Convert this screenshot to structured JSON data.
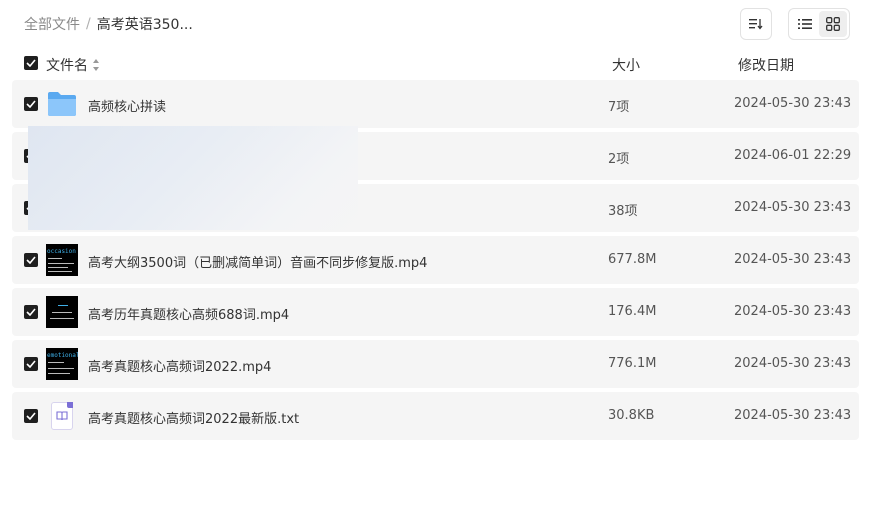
{
  "breadcrumb": {
    "root": "全部文件",
    "separator": "/",
    "current": "高考英语350..."
  },
  "header": {
    "name": "文件名",
    "size": "大小",
    "date": "修改日期"
  },
  "files": [
    {
      "name": "高频核心拼读",
      "type": "folder",
      "size": "7项",
      "date": "2024-05-30 23:43"
    },
    {
      "name": "",
      "type": "folder",
      "size": "2项",
      "date": "2024-06-01 22:29"
    },
    {
      "name": "",
      "type": "folder",
      "size": "38项",
      "date": "2024-05-30 23:43"
    },
    {
      "name": "高考大纲3500词（已删减简单词）音画不同步修复版.mp4",
      "type": "video",
      "size": "677.8M",
      "date": "2024-05-30 23:43",
      "thumb_text": "occasion"
    },
    {
      "name": "高考历年真题核心高频688词.mp4",
      "type": "video",
      "size": "176.4M",
      "date": "2024-05-30 23:43",
      "thumb_text": ""
    },
    {
      "name": "高考真题核心高频词2022.mp4",
      "type": "video",
      "size": "776.1M",
      "date": "2024-05-30 23:43",
      "thumb_text": "emotional"
    },
    {
      "name": "高考真题核心高频词2022最新版.txt",
      "type": "text",
      "size": "30.8KB",
      "date": "2024-05-30 23:43"
    }
  ],
  "colors": {
    "row_bg": "#f5f5f5",
    "checkbox": "#1f1f1f",
    "folder": "#5aa9f0",
    "txt_accent": "#7b6fd6"
  }
}
